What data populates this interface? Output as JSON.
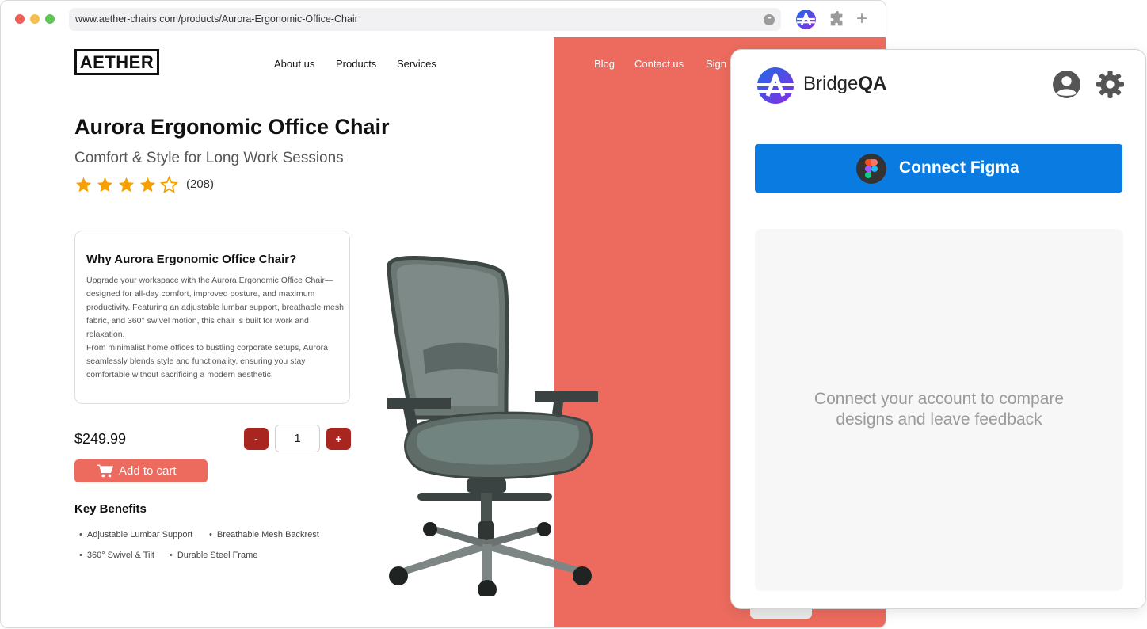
{
  "browser": {
    "url": "www.aether-chairs.com/products/Aurora-Ergonomic-Office-Chair",
    "url_more_glyph": "•••",
    "new_tab_glyph": "+",
    "icons": [
      "url-more-icon",
      "bridgeqa-extension-icon",
      "puzzle-icon",
      "plus-icon"
    ]
  },
  "site": {
    "logo": "AETHER",
    "nav_left": [
      "About us",
      "Products",
      "Services"
    ],
    "nav_right": [
      "Blog",
      "Contact us",
      "Sign u"
    ],
    "accent": "#ec6b5e",
    "dark_accent": "#a8261f"
  },
  "product": {
    "title": "Aurora Ergonomic Office Chair",
    "subtitle": "Comfort & Style for Long Work Sessions",
    "rating": 4,
    "rating_max": 5,
    "reviews": "(208)",
    "why_title": "Why Aurora Ergonomic Office Chair?",
    "why_p1": "Upgrade your workspace with the Aurora Ergonomic Office Chair—designed for all-day comfort, improved posture, and maximum productivity. Featuring an adjustable lumbar support, breathable mesh fabric, and 360° swivel motion, this chair is built for work and relaxation.",
    "why_p2": "From minimalist home offices to bustling corporate setups, Aurora seamlessly blends style and functionality, ensuring you stay comfortable without sacrificing a modern aesthetic.",
    "price": "$249.99",
    "minus": "-",
    "plus": "+",
    "quantity": "1",
    "add_to_cart": "Add to cart",
    "key_benefits_title": "Key Benefits",
    "benefits": [
      "Adjustable Lumbar Support",
      "Breathable Mesh Backrest",
      "360° Swivel & Tilt",
      "Durable Steel Frame"
    ]
  },
  "extension": {
    "brand_light": "Bridge",
    "brand_bold": "QA",
    "connect_label": "Connect Figma",
    "placeholder_line1": "Connect your account to compare",
    "placeholder_line2": "designs and leave feedback",
    "button_color": "#0a7be0",
    "icons": [
      "bridgeqa-logo-icon",
      "user-account-icon",
      "gear-icon",
      "figma-icon"
    ]
  }
}
